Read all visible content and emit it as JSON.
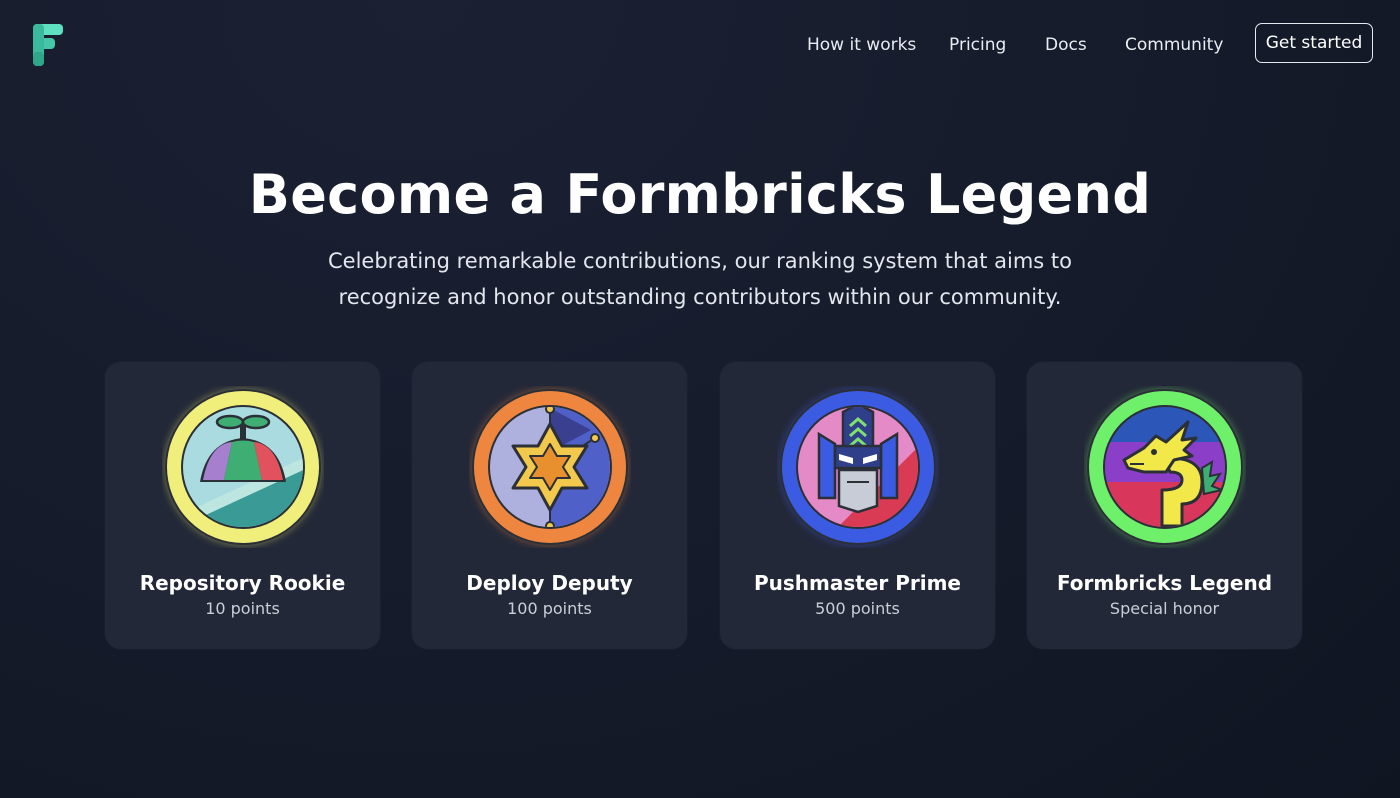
{
  "header": {
    "logo_icon": "formbricks-logo-icon",
    "nav": [
      "How it works",
      "Pricing",
      "Docs",
      "Community"
    ],
    "cta_label": "Get started"
  },
  "hero": {
    "title": "Become a Formbricks Legend",
    "subtitle": "Celebrating remarkable contributions, our ranking system that aims to recognize and honor outstanding contributors within our community."
  },
  "badges": [
    {
      "title": "Repository Rookie",
      "points": "10 points",
      "icon": "propeller-hat-icon",
      "ring_color": "#f1ef7c"
    },
    {
      "title": "Deploy Deputy",
      "points": "100 points",
      "icon": "sheriff-star-icon",
      "ring_color": "#ee8640"
    },
    {
      "title": "Pushmaster Prime",
      "points": "500 points",
      "icon": "robot-head-icon",
      "ring_color": "#3b5be2"
    },
    {
      "title": "Formbricks Legend",
      "points": "Special honor",
      "icon": "dragon-icon",
      "ring_color": "#6ff06a"
    }
  ],
  "colors": {
    "background": "#151b2a",
    "card": "#232838",
    "logo_green": "#4fd1b3"
  }
}
